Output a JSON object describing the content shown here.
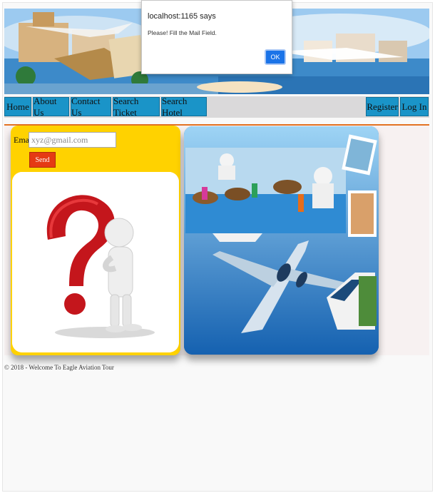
{
  "alert": {
    "title": "localhost:1165 says",
    "message": "Please! Fill the Mail Field.",
    "ok_label": "OK"
  },
  "nav": {
    "left": [
      "Home",
      "About Us",
      "Contact Us",
      "Search Ticket",
      "Search Hotel"
    ],
    "right": [
      "Register",
      "Log In"
    ]
  },
  "form": {
    "email_label": "Email:",
    "email_placeholder": "xyz@gmail.com",
    "send_label": "Send"
  },
  "footer": {
    "text": "© 2018 - Welcome To Eagle Aviation Tour"
  },
  "colors": {
    "nav_button": "#1a94c8",
    "nav_divider": "#e37222",
    "panel": "#ffd200",
    "send_button": "#e53a14",
    "ok_button": "#1a73e8"
  }
}
